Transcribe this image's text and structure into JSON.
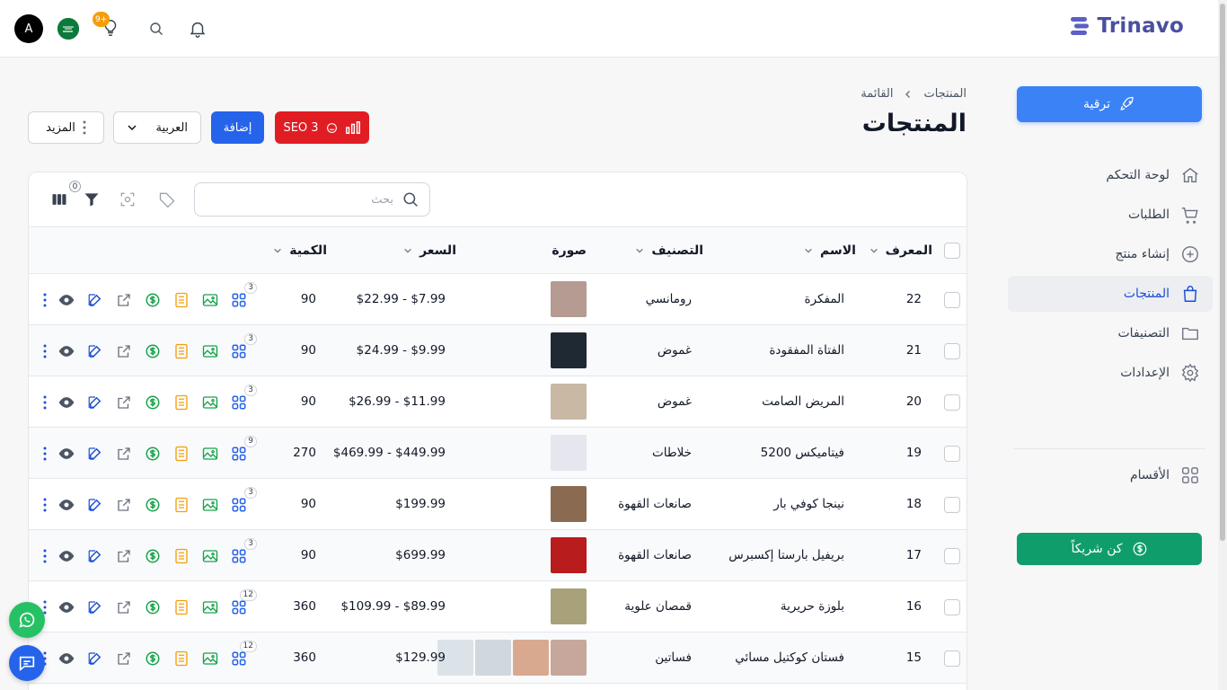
{
  "brand": {
    "name": "Trinavo"
  },
  "topbar": {
    "avatar_letter": "A",
    "notif_badge": "9+"
  },
  "sidebar": {
    "upgrade_label": "ترقية",
    "items": [
      {
        "label": "لوحة التحكم",
        "icon": "home-icon"
      },
      {
        "label": "الطلبات",
        "icon": "cart-icon"
      },
      {
        "label": "إنشاء منتج",
        "icon": "plus-circle-icon"
      },
      {
        "label": "المنتجات",
        "icon": "shopping-bag-icon",
        "active": true
      },
      {
        "label": "التصنيفات",
        "icon": "folder-icon"
      },
      {
        "label": "الإعدادات",
        "icon": "gear-icon"
      }
    ],
    "sections_label": "الأقسام",
    "partner_label": "كن شريكاً"
  },
  "breadcrumb": {
    "root": "المنتجات",
    "current": "القائمة"
  },
  "page": {
    "title": "المنتجات",
    "seo_label": "SEO 3",
    "add_label": "إضافة",
    "language": "العربية",
    "more_label": "المزيد"
  },
  "table": {
    "search_placeholder": "بحث",
    "filter_count": "0",
    "headers": {
      "id": "المعرف",
      "name": "الاسم",
      "category": "التصنيف",
      "image": "صورة",
      "price": "السعر",
      "quantity": "الكمية"
    },
    "rows": [
      {
        "id": "22",
        "name": "المفكرة",
        "category": "رومانسي",
        "price": "$22.99 - $7.99",
        "qty": "90",
        "variants": "3",
        "thumbs": [
          "#b59b92"
        ]
      },
      {
        "id": "21",
        "name": "الفتاة المفقودة",
        "category": "غموض",
        "price": "$24.99 - $9.99",
        "qty": "90",
        "variants": "3",
        "thumbs": [
          "#1f2933"
        ]
      },
      {
        "id": "20",
        "name": "المريض الصامت",
        "category": "غموض",
        "price": "$26.99 - $11.99",
        "qty": "90",
        "variants": "3",
        "thumbs": [
          "#c9b8a3"
        ]
      },
      {
        "id": "19",
        "name": "فيتاميكس 5200",
        "category": "خلاطات",
        "price": "$469.99 - $449.99",
        "qty": "270",
        "variants": "9",
        "thumbs": [
          "#e6e7ee"
        ]
      },
      {
        "id": "18",
        "name": "نينجا كوفي بار",
        "category": "صانعات القهوة",
        "price": "$199.99",
        "qty": "90",
        "variants": "3",
        "thumbs": [
          "#8a6b52"
        ]
      },
      {
        "id": "17",
        "name": "بريفيل بارستا إكسبرس",
        "category": "صانعات القهوة",
        "price": "$699.99",
        "qty": "90",
        "variants": "3",
        "thumbs": [
          "#b91c1c"
        ]
      },
      {
        "id": "16",
        "name": "بلوزة حريرية",
        "category": "قمصان علوية",
        "price": "$109.99 - $89.99",
        "qty": "360",
        "variants": "12",
        "thumbs": [
          "#a8a17a"
        ]
      },
      {
        "id": "15",
        "name": "فستان كوكتيل مسائي",
        "category": "فساتين",
        "price": "$129.99",
        "qty": "360",
        "variants": "12",
        "thumbs": [
          "#c7a79c",
          "#d9a98f",
          "#cfd8de",
          "#dbe3e8"
        ]
      }
    ]
  },
  "colors": {
    "primary": "#2563eb",
    "seo": "#e11d24",
    "partner": "#0f9d6b",
    "brand": "#4b4f9e",
    "whatsapp": "#25c164"
  }
}
